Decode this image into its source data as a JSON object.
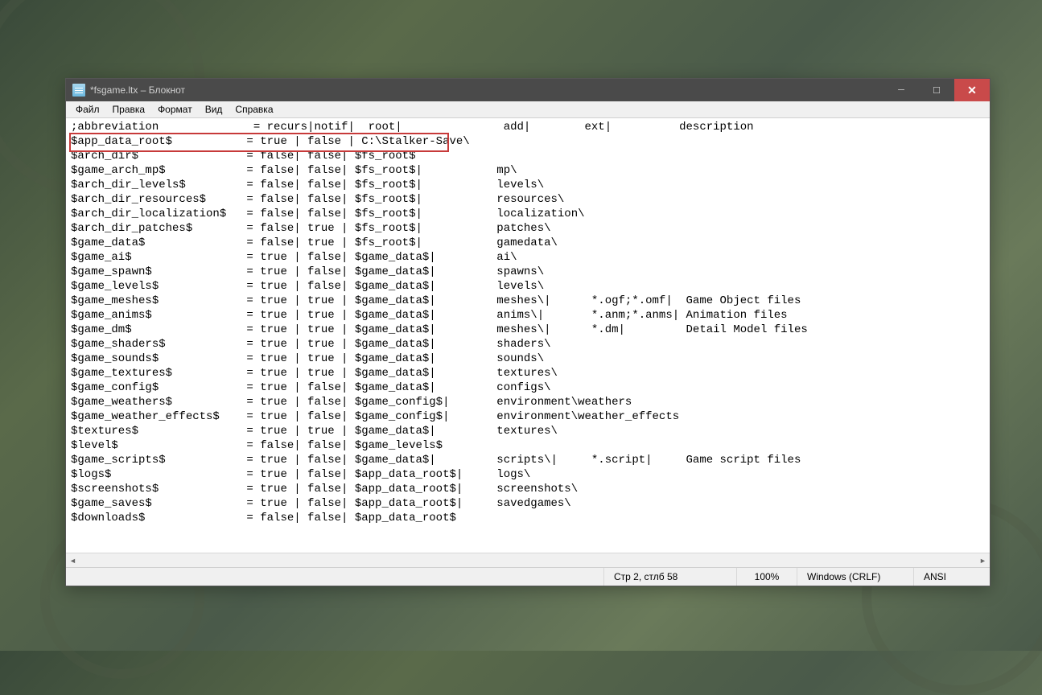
{
  "window": {
    "title": "*fsgame.ltx – Блокнот"
  },
  "menu": {
    "file": "Файл",
    "edit": "Правка",
    "format": "Формат",
    "view": "Вид",
    "help": "Справка"
  },
  "content": {
    "lines": [
      ";abbreviation              = recurs|notif|  root|               add|        ext|          description",
      "$app_data_root$           = true | false | C:\\Stalker-Save\\",
      "$arch_dir$                = false| false| $fs_root$",
      "$game_arch_mp$            = false| false| $fs_root$|           mp\\",
      "$arch_dir_levels$         = false| false| $fs_root$|           levels\\",
      "$arch_dir_resources$      = false| false| $fs_root$|           resources\\",
      "$arch_dir_localization$   = false| false| $fs_root$|           localization\\",
      "$arch_dir_patches$        = false| true | $fs_root$|           patches\\",
      "$game_data$               = false| true | $fs_root$|           gamedata\\",
      "$game_ai$                 = true | false| $game_data$|         ai\\",
      "$game_spawn$              = true | false| $game_data$|         spawns\\",
      "$game_levels$             = true | false| $game_data$|         levels\\",
      "$game_meshes$             = true | true | $game_data$|         meshes\\|      *.ogf;*.omf|  Game Object files",
      "$game_anims$              = true | true | $game_data$|         anims\\|       *.anm;*.anms| Animation files",
      "$game_dm$                 = true | true | $game_data$|         meshes\\|      *.dm|         Detail Model files",
      "$game_shaders$            = true | true | $game_data$|         shaders\\",
      "$game_sounds$             = true | true | $game_data$|         sounds\\",
      "$game_textures$           = true | true | $game_data$|         textures\\",
      "$game_config$             = true | false| $game_data$|         configs\\",
      "$game_weathers$           = true | false| $game_config$|       environment\\weathers",
      "$game_weather_effects$    = true | false| $game_config$|       environment\\weather_effects",
      "$textures$                = true | true | $game_data$|         textures\\",
      "$level$                   = false| false| $game_levels$",
      "$game_scripts$            = true | false| $game_data$|         scripts\\|     *.script|     Game script files",
      "$logs$                    = true | false| $app_data_root$|     logs\\",
      "$screenshots$             = true | false| $app_data_root$|     screenshots\\",
      "$game_saves$              = true | false| $app_data_root$|     savedgames\\",
      "$downloads$               = false| false| $app_data_root$"
    ]
  },
  "status": {
    "position": "Стр 2, стлб 58",
    "zoom": "100%",
    "lineending": "Windows (CRLF)",
    "encoding": "ANSI"
  },
  "winbtns": {
    "min": "─",
    "max": "☐",
    "close": "✕"
  }
}
